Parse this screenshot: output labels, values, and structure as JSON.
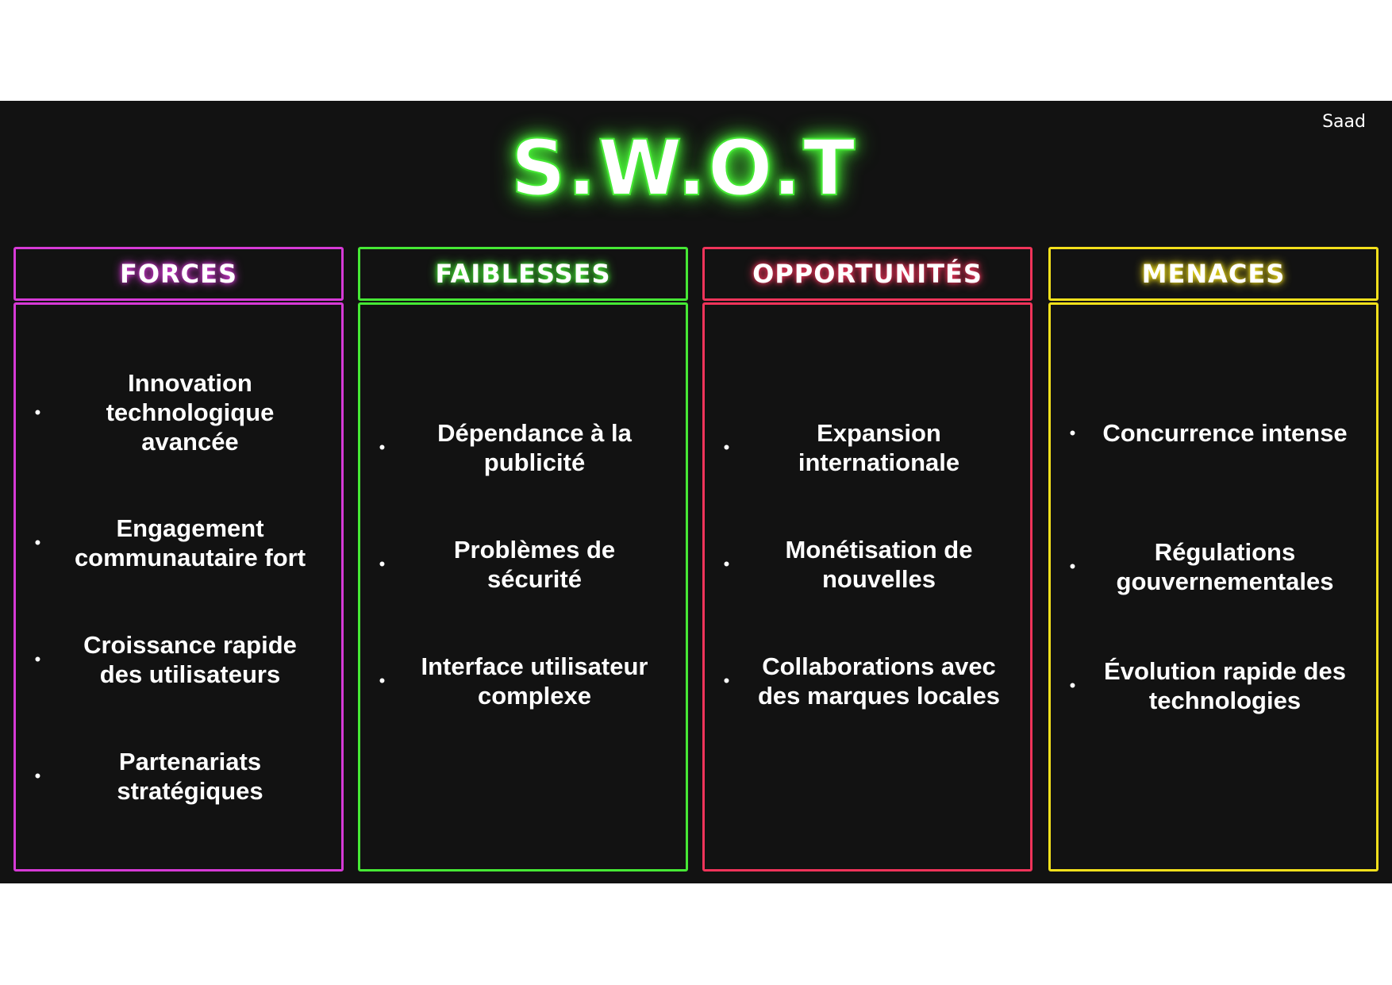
{
  "author": "Saad",
  "title": "S.W.O.T",
  "colors": {
    "background": "#121212",
    "forces": "#d63ad6",
    "faiblesses": "#46e835",
    "opportunites": "#f0345a",
    "menaces": "#f3e01c"
  },
  "columns": [
    {
      "title": "FORCES",
      "color": "#d63ad6",
      "items": [
        "Innovation technologique avancée",
        "Engagement communautaire fort",
        "Croissance rapide des utilisateurs",
        "Partenariats stratégiques"
      ]
    },
    {
      "title": "FAIBLESSES",
      "color": "#46e835",
      "items": [
        "Dépendance à la publicité",
        "Problèmes de sécurité",
        "Interface utilisateur complexe"
      ]
    },
    {
      "title": "OPPORTUNITÉS",
      "color": "#f0345a",
      "items": [
        "Expansion internationale",
        "Monétisation de nouvelles",
        "Collaborations avec des marques locales"
      ]
    },
    {
      "title": "MENACES",
      "color": "#f3e01c",
      "items": [
        "Concurrence intense",
        "Régulations gouvernementales",
        "Évolution rapide des technologies"
      ]
    }
  ]
}
